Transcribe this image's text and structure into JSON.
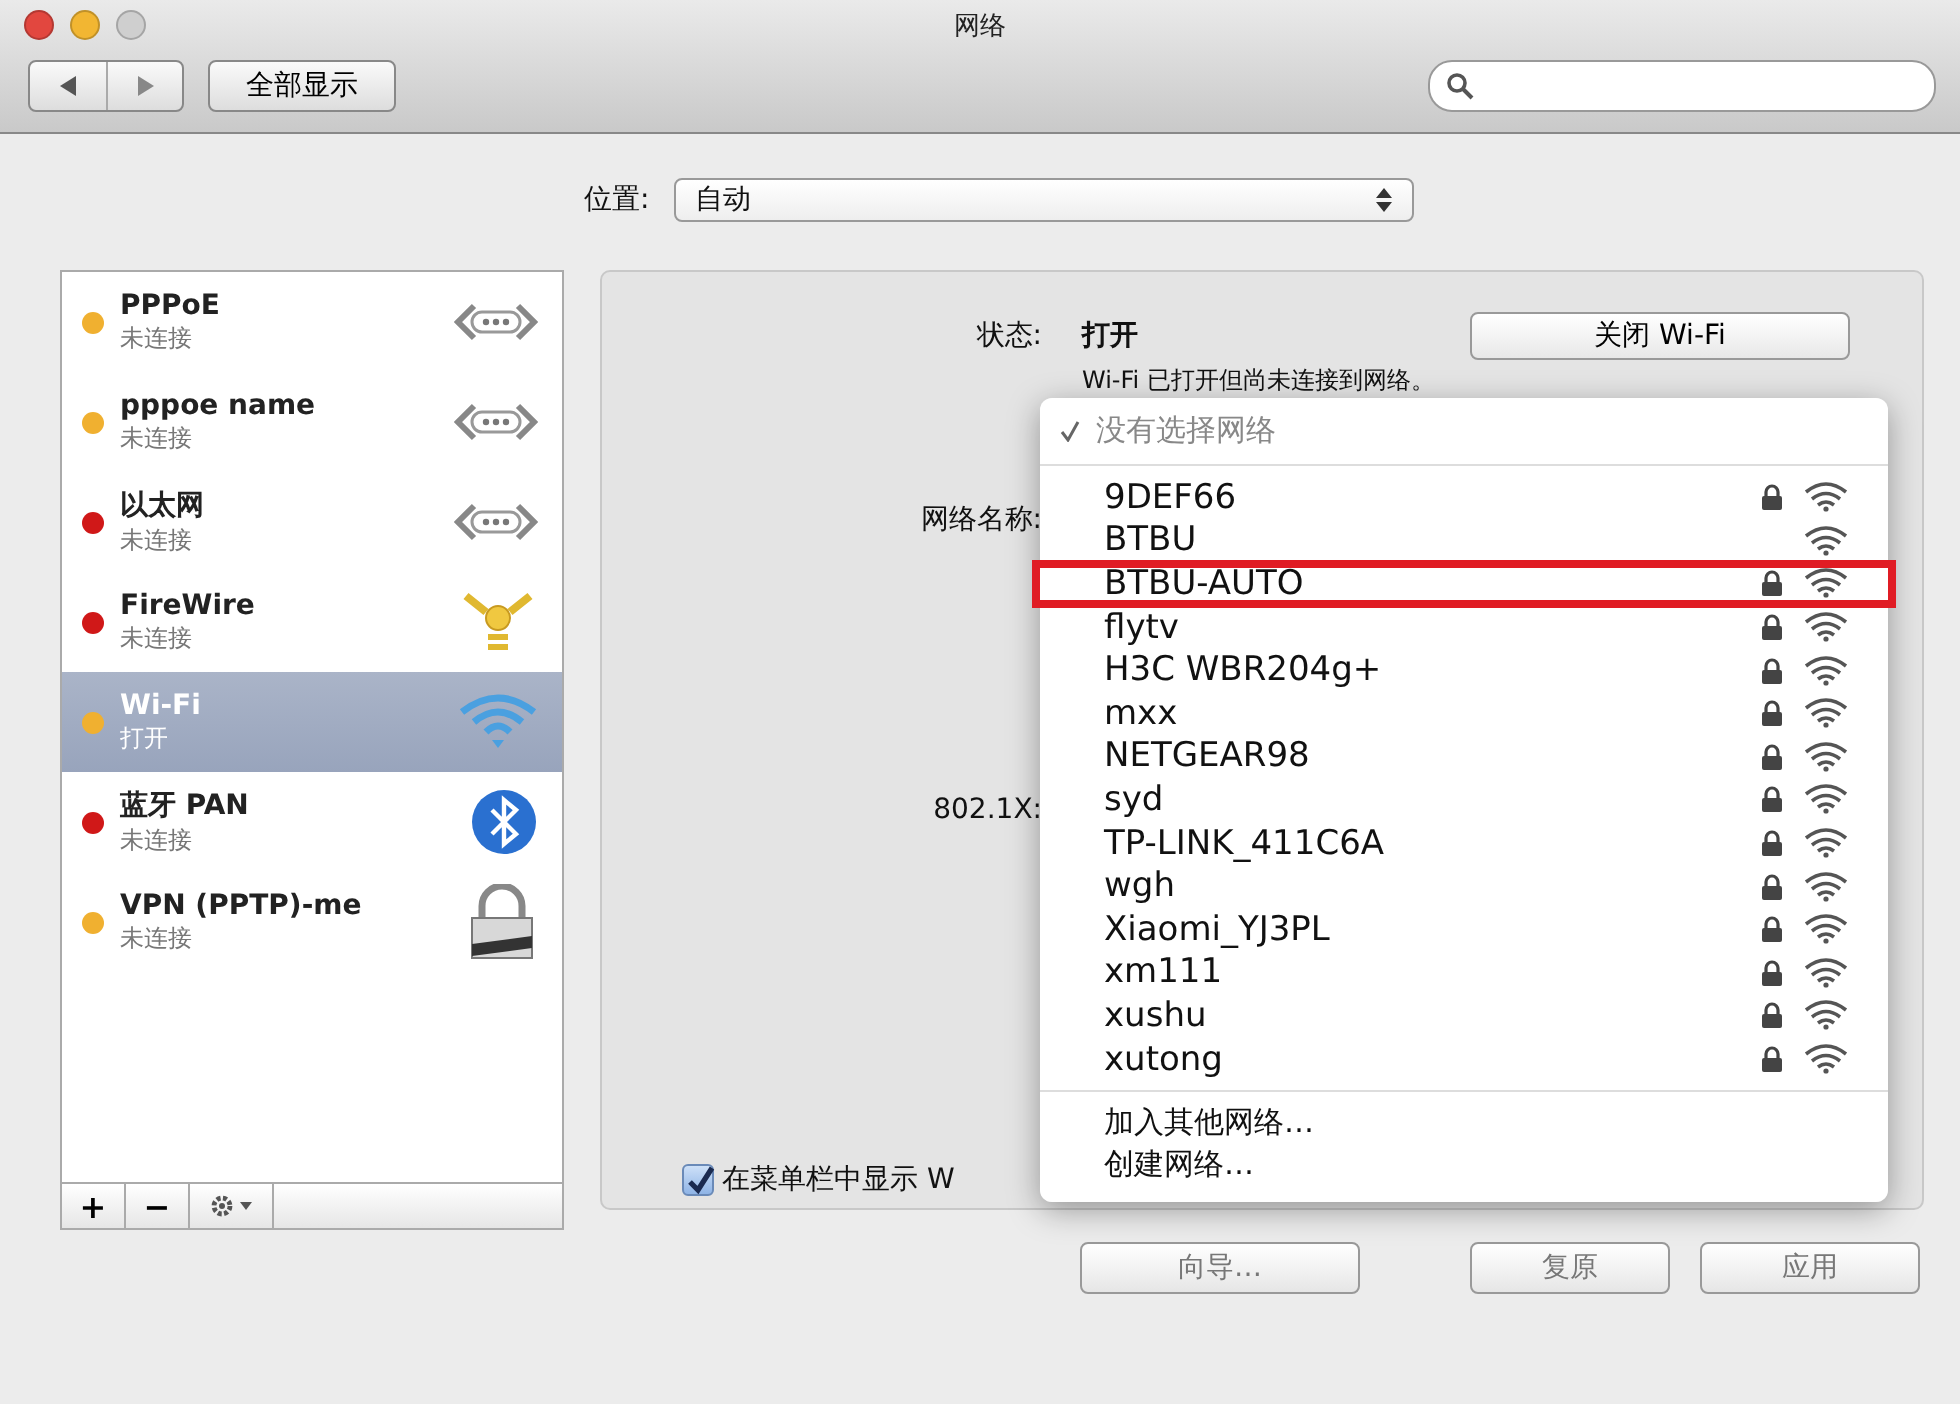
{
  "window": {
    "title": "网络"
  },
  "toolbar": {
    "show_all": "全部显示"
  },
  "location": {
    "label": "位置:",
    "value": "自动"
  },
  "services": [
    {
      "name": "PPPoE",
      "status": "未连接",
      "color": "#f0b030",
      "kind": "ethernet",
      "selected": false
    },
    {
      "name": "pppoe name",
      "status": "未连接",
      "color": "#f0b030",
      "kind": "ethernet",
      "selected": false
    },
    {
      "name": "以太网",
      "status": "未连接",
      "color": "#d01818",
      "kind": "ethernet",
      "selected": false
    },
    {
      "name": "FireWire",
      "status": "未连接",
      "color": "#d01818",
      "kind": "firewire",
      "selected": false
    },
    {
      "name": "Wi-Fi",
      "status": "打开",
      "color": "#f0b030",
      "kind": "wifi",
      "selected": true
    },
    {
      "name": "蓝牙 PAN",
      "status": "未连接",
      "color": "#d01818",
      "kind": "bluetooth",
      "selected": false
    },
    {
      "name": "VPN (PPTP)-me",
      "status": "未连接",
      "color": "#f0b030",
      "kind": "vpn",
      "selected": false
    }
  ],
  "sidebar_buttons": [
    "+",
    "−"
  ],
  "panel": {
    "status_label": "状态:",
    "status_value": "打开",
    "toggle_button": "关闭 Wi-Fi",
    "status_note": "Wi-Fi 已打开但尚未连接到网络。",
    "network_label": "网络名称:",
    "x8021_label": "802.1X:",
    "menubar_checkbox": {
      "label": "在菜单栏中显示 W",
      "checked": true
    }
  },
  "network_menu": {
    "current": {
      "label": "没有选择网络",
      "checked": true
    },
    "networks": [
      {
        "name": "9DEF66",
        "locked": true,
        "highlighted": false
      },
      {
        "name": "BTBU",
        "locked": false,
        "highlighted": false
      },
      {
        "name": "BTBU-AUTO",
        "locked": true,
        "highlighted": true
      },
      {
        "name": "flytv",
        "locked": true,
        "highlighted": false
      },
      {
        "name": "H3C WBR204g+",
        "locked": true,
        "highlighted": false
      },
      {
        "name": "mxx",
        "locked": true,
        "highlighted": false
      },
      {
        "name": "NETGEAR98",
        "locked": true,
        "highlighted": false
      },
      {
        "name": "syd",
        "locked": true,
        "highlighted": false
      },
      {
        "name": "TP-LINK_411C6A",
        "locked": true,
        "highlighted": false
      },
      {
        "name": "wgh",
        "locked": true,
        "highlighted": false
      },
      {
        "name": "Xiaomi_YJ3PL",
        "locked": true,
        "highlighted": false
      },
      {
        "name": "xm111",
        "locked": true,
        "highlighted": false
      },
      {
        "name": "xushu",
        "locked": true,
        "highlighted": false
      },
      {
        "name": "xutong",
        "locked": true,
        "highlighted": false
      }
    ],
    "actions": [
      "加入其他网络…",
      "创建网络…"
    ]
  },
  "footer_buttons": [
    "向导…",
    "复原",
    "应用"
  ]
}
